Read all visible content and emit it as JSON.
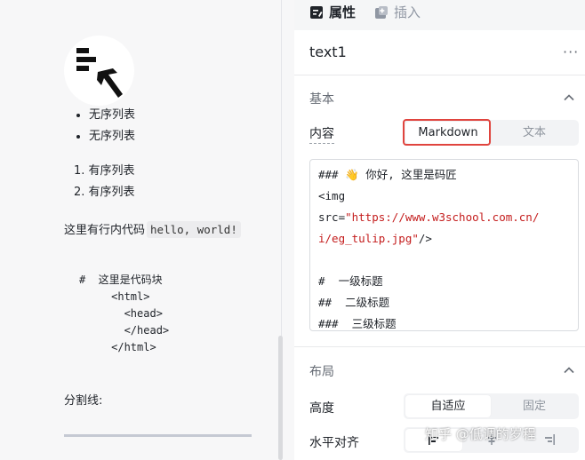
{
  "preview": {
    "unordered_list": [
      "无序列表",
      "无序列表"
    ],
    "ordered_list": [
      "1. 有序列表",
      "2. 有序列表"
    ],
    "inline_text": "这里有行内代码",
    "inline_code": "hello, world!",
    "code_block": "#  这里是代码块\n     <html>\n       <head>\n       </head>\n     </html>",
    "hr_label": "分割线:"
  },
  "panel": {
    "tabs": [
      {
        "label": "属性",
        "icon": "properties-icon",
        "active": true
      },
      {
        "label": "插入",
        "icon": "insert-icon",
        "active": false
      }
    ],
    "component_name": "text1",
    "more_label": "···",
    "basic_section": {
      "title": "基本",
      "content_label": "内容",
      "content_options": [
        "Markdown",
        "文本"
      ],
      "content_selected": "Markdown",
      "editor_lines": {
        "l1": "### 👋 你好, 这里是码匠",
        "l2": "<img",
        "l3_attr": "src=",
        "l3_val": "\"https://www.w3school.com.cn/",
        "l4_val": "i/eg_tulip.jpg\"",
        "l4_end": "/>",
        "l5": "",
        "l6": "#  一级标题",
        "l7": "##  二级标题",
        "l8": "###  三级标题"
      }
    },
    "layout_section": {
      "title": "布局",
      "height_label": "高度",
      "height_options": [
        "自适应",
        "固定"
      ],
      "height_selected": "自适应",
      "align_label": "水平对齐"
    },
    "highlight_color": "#e0443e"
  },
  "watermark": "知乎 @低调的岁程"
}
